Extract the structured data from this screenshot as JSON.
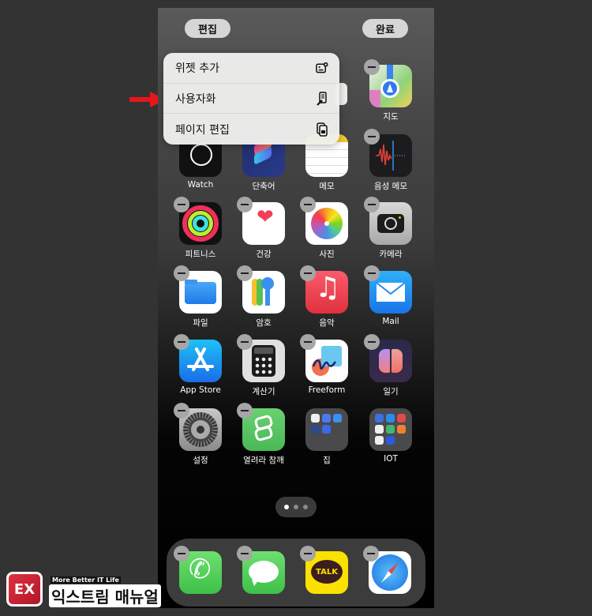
{
  "header": {
    "edit_label": "편집",
    "done_label": "완료"
  },
  "context_menu": {
    "items": [
      {
        "label": "위젯 추가",
        "icon": "add-widget-icon"
      },
      {
        "label": "사용자화",
        "icon": "customize-icon"
      },
      {
        "label": "페이지 편집",
        "icon": "edit-pages-icon"
      }
    ]
  },
  "apps": [
    {
      "label": "지도",
      "icon": "maps-icon"
    },
    {
      "label": "Watch",
      "icon": "watch-icon"
    },
    {
      "label": "단축어",
      "icon": "shortcuts-icon"
    },
    {
      "label": "메모",
      "icon": "notes-icon"
    },
    {
      "label": "음성 메모",
      "icon": "voice-memo-icon"
    },
    {
      "label": "피트니스",
      "icon": "fitness-icon"
    },
    {
      "label": "건강",
      "icon": "health-icon"
    },
    {
      "label": "사진",
      "icon": "photos-icon"
    },
    {
      "label": "카메라",
      "icon": "camera-icon"
    },
    {
      "label": "파일",
      "icon": "files-icon"
    },
    {
      "label": "암호",
      "icon": "passwords-icon"
    },
    {
      "label": "음악",
      "icon": "music-icon"
    },
    {
      "label": "Mail",
      "icon": "mail-icon"
    },
    {
      "label": "App Store",
      "icon": "app-store-icon"
    },
    {
      "label": "계산기",
      "icon": "calculator-icon"
    },
    {
      "label": "Freeform",
      "icon": "freeform-icon"
    },
    {
      "label": "일기",
      "icon": "journal-icon"
    },
    {
      "label": "설정",
      "icon": "settings-icon"
    },
    {
      "label": "열려라 참깨",
      "icon": "open-sesame-icon"
    },
    {
      "label": "집",
      "icon": "folder-icon"
    },
    {
      "label": "IOT",
      "icon": "folder-icon"
    }
  ],
  "page_indicator": {
    "pages": 3,
    "current": 1
  },
  "dock": [
    {
      "label": "Phone",
      "icon": "phone-icon"
    },
    {
      "label": "Messages",
      "icon": "messages-icon"
    },
    {
      "label": "KakaoTalk",
      "icon": "kakaotalk-icon",
      "text": "TALK"
    },
    {
      "label": "Safari",
      "icon": "safari-icon"
    }
  ],
  "watermark": {
    "tagline": "More Better IT Life",
    "name": "익스트림 매뉴얼",
    "mark": "EX"
  },
  "colors": {
    "arrow": "#e8161b",
    "menu_bg": "#eef0ec"
  }
}
